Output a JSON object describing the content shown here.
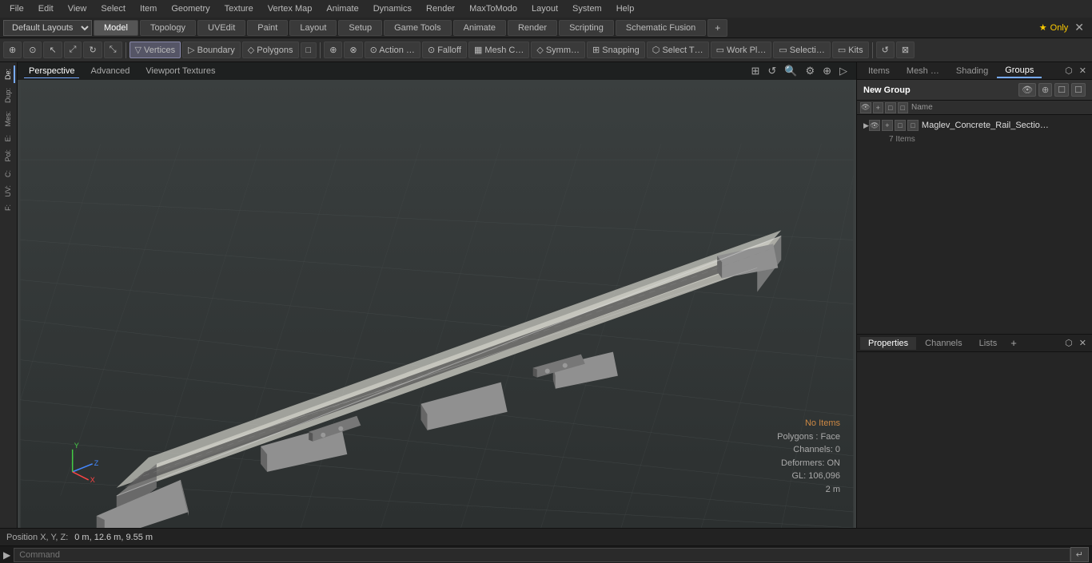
{
  "menubar": {
    "items": [
      "File",
      "Edit",
      "View",
      "Select",
      "Item",
      "Geometry",
      "Texture",
      "Vertex Map",
      "Animate",
      "Dynamics",
      "Render",
      "MaxToModo",
      "Layout",
      "System",
      "Help"
    ]
  },
  "layoutbar": {
    "dropdown": "Default Layouts",
    "tabs": [
      "Model",
      "Topology",
      "UVEdit",
      "Paint",
      "Layout",
      "Setup",
      "Game Tools",
      "Animate",
      "Render",
      "Scripting",
      "Schematic Fusion"
    ],
    "active_tab": "Model",
    "add_icon": "+",
    "star_label": "★ Only",
    "close_icon": "✕"
  },
  "toolsbar": {
    "items": [
      {
        "label": "⊕",
        "name": "add-tool"
      },
      {
        "label": "⊙",
        "name": "circle-tool"
      },
      {
        "label": "△",
        "name": "triangle-tool"
      },
      {
        "label": "□",
        "name": "select-tool"
      },
      {
        "label": "⌂",
        "name": "house-tool"
      },
      {
        "label": "⬡",
        "name": "hex-tool"
      },
      {
        "label": "▽ Vertices",
        "name": "vertices-btn"
      },
      {
        "label": "▷ Boundary",
        "name": "boundary-btn"
      },
      {
        "label": "◇ Polygons",
        "name": "polygons-btn"
      },
      {
        "label": "□",
        "name": "square-tool2"
      },
      {
        "label": "⊕",
        "name": "add-tool2"
      },
      {
        "label": "⊗",
        "name": "cross-tool"
      },
      {
        "label": "⊙ Action …",
        "name": "action-btn"
      },
      {
        "label": "⊙ Falloff",
        "name": "falloff-btn"
      },
      {
        "label": "▦ Mesh C…",
        "name": "mesh-btn"
      },
      {
        "label": "◇ Symm…",
        "name": "symm-btn"
      },
      {
        "label": "⊞ Snapping",
        "name": "snapping-btn"
      },
      {
        "label": "⬡ Select T…",
        "name": "select-type-btn"
      },
      {
        "label": "▭ Work Pl…",
        "name": "workplane-btn"
      },
      {
        "label": "▭ Selecti…",
        "name": "selection-btn"
      },
      {
        "label": "▭ Kits",
        "name": "kits-btn"
      },
      {
        "label": "↺",
        "name": "rotate-icon"
      },
      {
        "label": "⊠",
        "name": "grid-icon"
      }
    ]
  },
  "viewport": {
    "tabs": [
      "Perspective",
      "Advanced",
      "Viewport Textures"
    ],
    "active_tab": "Perspective",
    "status": {
      "no_items": "No Items",
      "polygons": "Polygons : Face",
      "channels": "Channels: 0",
      "deformers": "Deformers: ON",
      "gl": "GL: 106,096",
      "scale": "2 m"
    },
    "icons": [
      "⊞",
      "↺",
      "🔍",
      "⚙",
      "⊕",
      "▷"
    ]
  },
  "left_sidebar": {
    "tabs": [
      "De:",
      "Dup:",
      "Mes:",
      "E:",
      "Pol:",
      "C:",
      "UV:",
      "F:"
    ]
  },
  "right_panel": {
    "top_tabs": [
      "Items",
      "Mesh …",
      "Shading",
      "Groups"
    ],
    "active_top_tab": "Groups",
    "new_group_label": "New Group",
    "col_headers": [
      "Name"
    ],
    "groups_header_icons": [
      "👁",
      "⊕",
      "☐",
      "☐"
    ],
    "group_row_icons": [
      "👁",
      "⊕",
      "☐",
      "☐"
    ],
    "group_name": "Maglev_Concrete_Rail_Sectio…",
    "group_count": "7 Items",
    "bottom_tabs": [
      "Properties",
      "Channels",
      "Lists"
    ],
    "active_bottom_tab": "Properties",
    "bottom_add": "+"
  },
  "bottombar": {
    "pos_label": "Position X, Y, Z:",
    "pos_value": "0 m, 12.6 m, 9.55 m"
  },
  "commandbar": {
    "arrow": "▶",
    "placeholder": "Command",
    "enter_icon": "↵"
  }
}
